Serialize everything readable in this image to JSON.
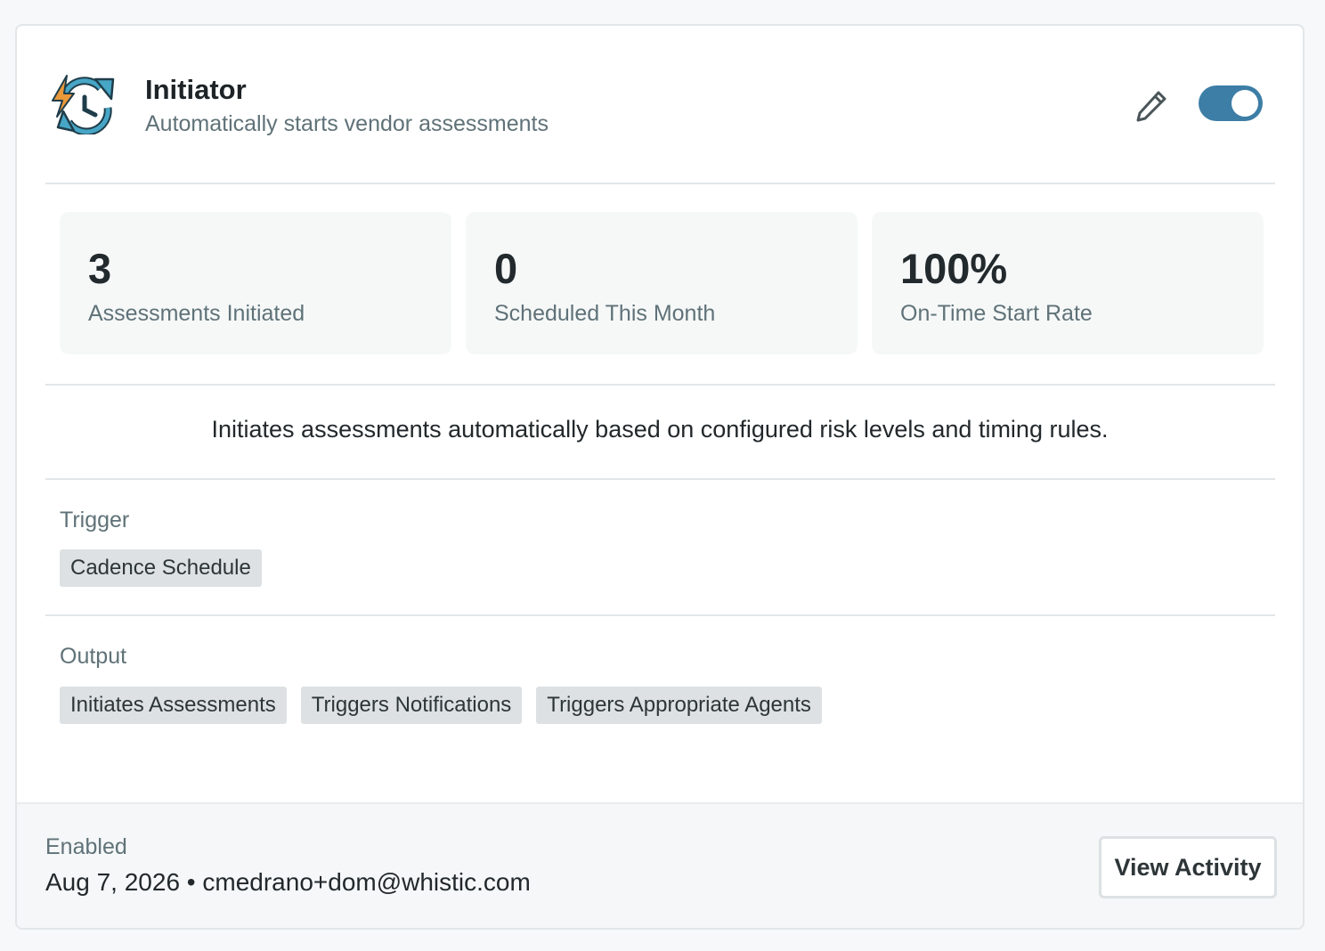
{
  "agent": {
    "title": "Initiator",
    "subtitle": "Automatically starts vendor assessments",
    "icon": "sync-lightning-icon",
    "enabled": true
  },
  "stats": [
    {
      "value": "3",
      "label": "Assessments Initiated"
    },
    {
      "value": "0",
      "label": "Scheduled This Month"
    },
    {
      "value": "100%",
      "label": "On-Time Start Rate"
    }
  ],
  "description": "Initiates assessments automatically based on configured risk levels and timing rules.",
  "trigger": {
    "label": "Trigger",
    "chips": [
      "Cadence Schedule"
    ]
  },
  "output": {
    "label": "Output",
    "chips": [
      "Initiates Assessments",
      "Triggers Notifications",
      "Triggers Appropriate Agents"
    ]
  },
  "footer": {
    "status": "Enabled",
    "meta": "Aug 7, 2026 • cmedrano+dom@whistic.com",
    "view_activity_label": "View Activity"
  },
  "colors": {
    "accent": "#3d7ea6",
    "icon_blue": "#47a6c6",
    "icon_orange": "#e9983a"
  }
}
